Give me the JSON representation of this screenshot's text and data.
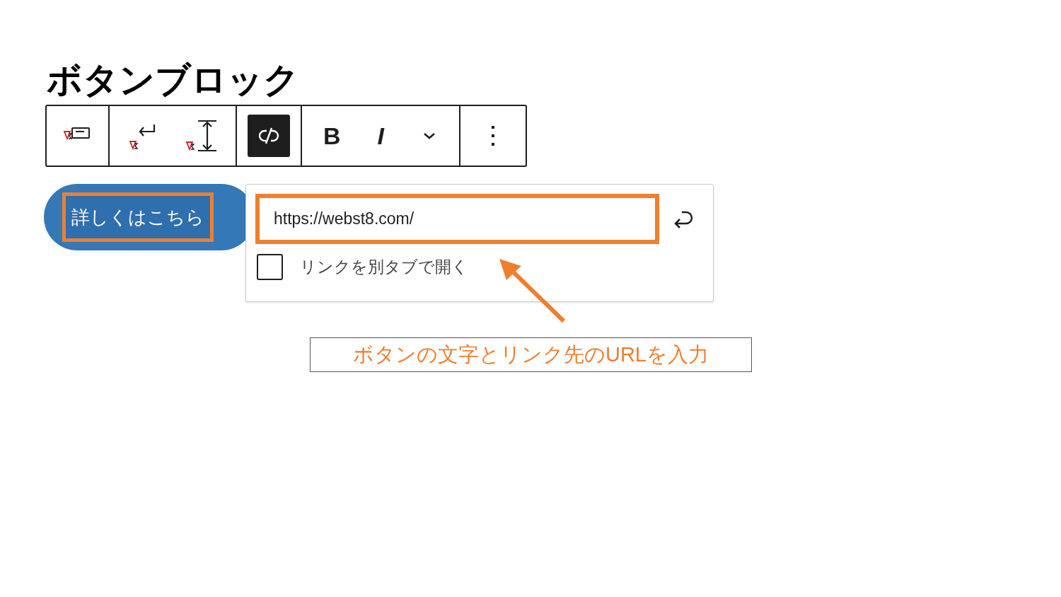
{
  "heading": "ボタンブロック",
  "toolbar": {
    "groups": [
      [
        {
          "kind": "transform",
          "pressed": false
        }
      ],
      [
        {
          "kind": "wrap",
          "pressed": false
        },
        {
          "kind": "height",
          "pressed": false
        }
      ],
      [
        {
          "kind": "unlink",
          "pressed": true
        }
      ],
      [
        {
          "kind": "text",
          "label": "B",
          "pressed": false
        },
        {
          "kind": "text",
          "label": "I",
          "pressed": false
        },
        {
          "kind": "chevron",
          "pressed": false
        }
      ],
      [
        {
          "kind": "dots",
          "pressed": false
        }
      ]
    ]
  },
  "button": {
    "label": "詳しくはこちら"
  },
  "link_popover": {
    "url": "https://webst8.com/",
    "new_tab": {
      "label": "リンクを別タブで開く",
      "checked": false
    }
  },
  "caption": "ボタンの文字とリンク先のURLを入力"
}
